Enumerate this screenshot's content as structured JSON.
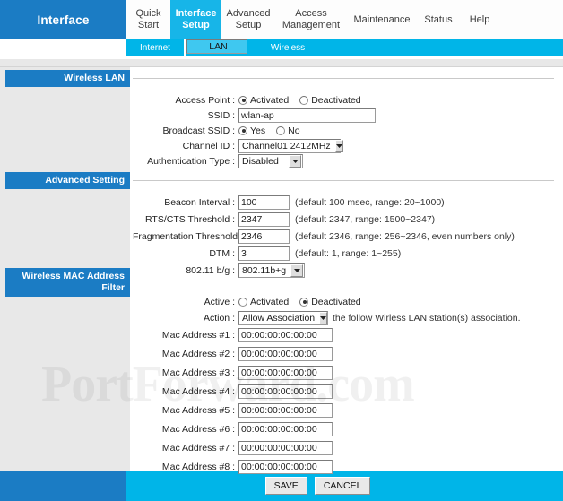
{
  "header": {
    "logo_label": "Interface",
    "main_tabs": [
      {
        "label": "Quick\nStart",
        "active": false
      },
      {
        "label": "Interface\nSetup",
        "active": true
      },
      {
        "label": "Advanced\nSetup",
        "active": false
      },
      {
        "label": "Access\nManagement",
        "active": false
      },
      {
        "label": "Maintenance",
        "active": false
      },
      {
        "label": "Status",
        "active": false
      },
      {
        "label": "Help",
        "active": false
      }
    ],
    "sub_tabs": [
      {
        "label": "Internet",
        "selected": false
      },
      {
        "label": "LAN",
        "selected": true
      },
      {
        "label": "Wireless",
        "selected": false
      }
    ]
  },
  "watermark": "PortForward.com",
  "sections": {
    "wireless_lan": {
      "title": "Wireless LAN",
      "access_point": {
        "label": "Access Point :",
        "options": [
          "Activated",
          "Deactivated"
        ],
        "selected": "Activated"
      },
      "ssid": {
        "label": "SSID :",
        "value": "wlan-ap"
      },
      "broadcast_ssid": {
        "label": "Broadcast SSID :",
        "options": [
          "Yes",
          "No"
        ],
        "selected": "Yes"
      },
      "channel_id": {
        "label": "Channel ID :",
        "value": "Channel01 2412MHz"
      },
      "authentication_type": {
        "label": "Authentication Type :",
        "value": "Disabled"
      }
    },
    "advanced_setting": {
      "title": "Advanced Setting",
      "beacon_interval": {
        "label": "Beacon Interval :",
        "value": "100",
        "hint": "(default 100 msec, range: 20~1000)"
      },
      "rts_cts_threshold": {
        "label": "RTS/CTS Threshold :",
        "value": "2347",
        "hint": "(default 2347, range: 1500~2347)"
      },
      "fragmentation_threshold": {
        "label": "Fragmentation Threshold :",
        "value": "2346",
        "hint": "(default 2346, range: 256~2346, even numbers only)"
      },
      "dtm": {
        "label": "DTM :",
        "value": "3",
        "hint": "(default: 1, range: 1~255)"
      },
      "mode_802_11": {
        "label": "802.11 b/g :",
        "value": "802.11b+g"
      }
    },
    "mac_filter": {
      "title_line1": "Wireless MAC Address",
      "title_line2": "Filter",
      "active": {
        "label": "Active :",
        "options": [
          "Activated",
          "Deactivated"
        ],
        "selected": "Deactivated"
      },
      "action": {
        "label": "Action :",
        "value": "Allow Association",
        "tail_text": "the follow Wirless LAN station(s) association."
      },
      "mac_addresses": [
        {
          "label": "Mac Address #1 :",
          "value": "00:00:00:00:00:00"
        },
        {
          "label": "Mac Address #2 :",
          "value": "00:00:00:00:00:00"
        },
        {
          "label": "Mac Address #3 :",
          "value": "00:00:00:00:00:00"
        },
        {
          "label": "Mac Address #4 :",
          "value": "00:00:00:00:00:00"
        },
        {
          "label": "Mac Address #5 :",
          "value": "00:00:00:00:00:00"
        },
        {
          "label": "Mac Address #6 :",
          "value": "00:00:00:00:00:00"
        },
        {
          "label": "Mac Address #7 :",
          "value": "00:00:00:00:00:00"
        },
        {
          "label": "Mac Address #8 :",
          "value": "00:00:00:00:00:00"
        }
      ]
    }
  },
  "footer": {
    "save_label": "SAVE",
    "cancel_label": "CANCEL"
  },
  "colors": {
    "brand_dark_blue": "#1b7cc4",
    "brand_cyan": "#00b5e8",
    "active_tab": "#17b5e8",
    "panel_gray": "#e8e8e8"
  }
}
